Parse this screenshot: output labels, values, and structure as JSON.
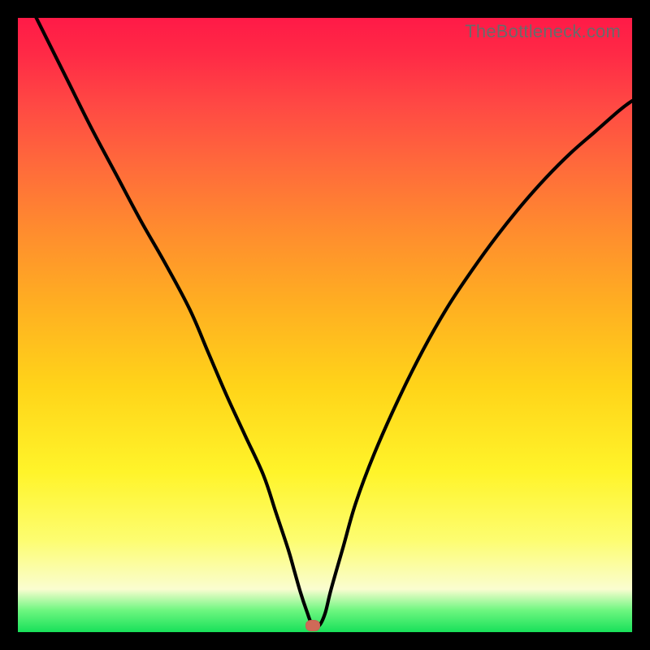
{
  "watermark": "TheBottleneck.com",
  "colors": {
    "frame": "#000000",
    "curve": "#000000",
    "marker": "#cf6a58"
  },
  "chart_data": {
    "type": "line",
    "title": "",
    "xlabel": "",
    "ylabel": "",
    "xlim": [
      0,
      100
    ],
    "ylim": [
      0,
      100
    ],
    "marker": {
      "x": 48,
      "y": 1
    },
    "series": [
      {
        "name": "bottleneck-curve",
        "x": [
          0,
          4,
          8,
          12,
          16,
          20,
          24,
          28,
          31,
          34,
          37,
          40,
          42,
          44,
          45,
          46,
          47,
          48,
          49,
          50,
          51,
          53,
          55,
          58,
          62,
          66,
          70,
          74,
          78,
          82,
          86,
          90,
          94,
          98,
          100
        ],
        "y": [
          106,
          98,
          90,
          82,
          74.5,
          67,
          60,
          52.5,
          45.5,
          38.5,
          32,
          25.5,
          19.5,
          13.5,
          10,
          6.5,
          3.5,
          1,
          1,
          3,
          7,
          14,
          21,
          29,
          38,
          46,
          53,
          59,
          64.5,
          69.5,
          74,
          78,
          81.5,
          85,
          86.5
        ]
      }
    ]
  }
}
